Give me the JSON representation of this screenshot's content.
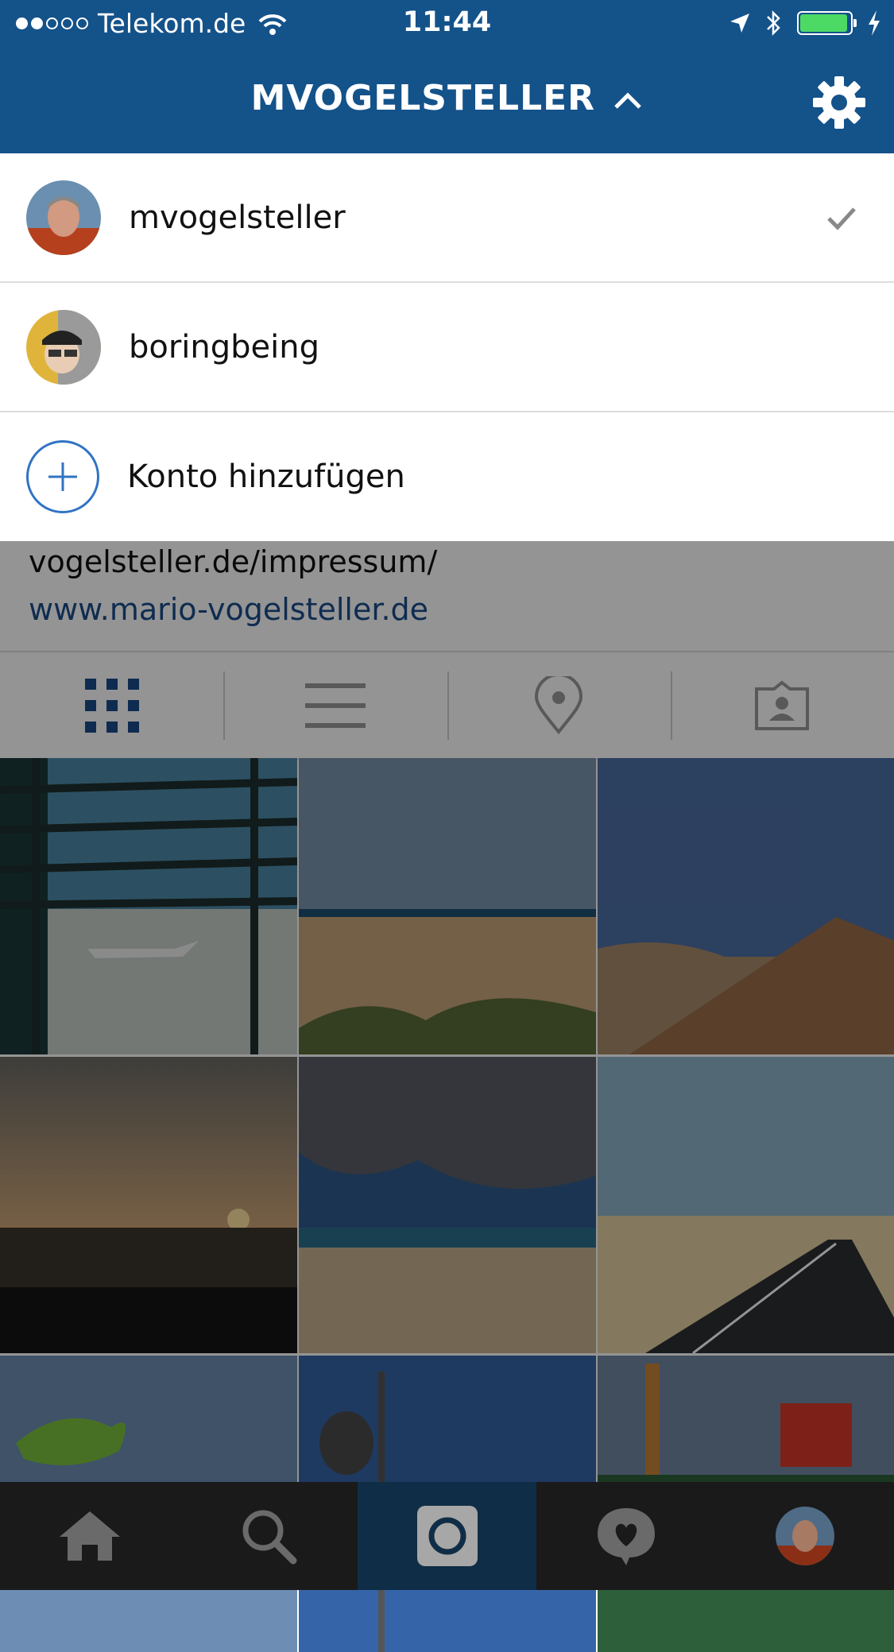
{
  "status_bar": {
    "carrier": "Telekom.de",
    "time": "11:44",
    "signal_dots_filled": 2,
    "signal_dots_total": 5,
    "battery_level": 0.95
  },
  "header": {
    "title": "MVOGELSTELLER",
    "chevron_icon": "chevron-up-icon",
    "settings_icon": "gear-icon"
  },
  "account_menu": {
    "items": [
      {
        "username": "mvogelsteller",
        "selected": true
      },
      {
        "username": "boringbeing",
        "selected": false
      }
    ],
    "add_account_label": "Konto hinzufügen"
  },
  "profile": {
    "bio_line": "vogelsteller.de/impressum/",
    "website": "www.mario-vogelsteller.de"
  },
  "tabs": [
    "grid-icon",
    "list-icon",
    "location-pin-icon",
    "tagged-person-icon"
  ],
  "photo_grid": {
    "photos": [
      "airport-window",
      "beach-dunes",
      "rocky-hill",
      "sunset-dunes",
      "cloudy-beach",
      "desert-road",
      "frog-kite",
      "statues",
      "colorful-sculptures"
    ]
  },
  "bottom_nav": [
    "home-icon",
    "search-icon",
    "camera-icon",
    "activity-heart-icon",
    "profile-avatar"
  ],
  "colors": {
    "header_bg": "#14528a",
    "accent_blue": "#3173c4",
    "link_blue": "#1b4d8a",
    "battery_green": "#4cd964"
  }
}
